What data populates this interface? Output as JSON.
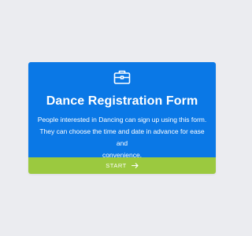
{
  "form": {
    "icon": "briefcase-icon",
    "title": "Dance Registration Form",
    "description_lines": [
      "People interested in Dancing can sign up using this form.",
      "They can choose the time and date in advance for ease and",
      "convenience."
    ],
    "start_label": "START",
    "start_icon": "arrow-right-icon"
  },
  "colors": {
    "page_background": "#ebecf0",
    "card_background": "#0a78e6",
    "start_bar": "#9bc93f",
    "text": "#ffffff"
  }
}
